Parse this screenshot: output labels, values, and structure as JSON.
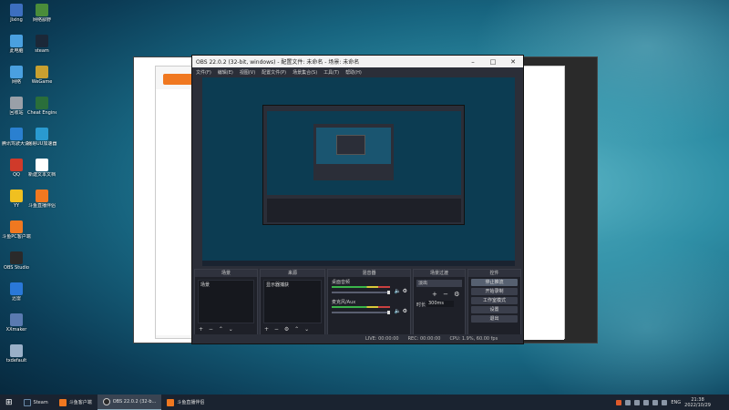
{
  "desktop": {
    "icons": [
      {
        "label": "Jixing",
        "color": "#3d6fbf"
      },
      {
        "label": "网络鄙野",
        "color": "#4a8c3a"
      },
      {
        "label": "此电脑",
        "color": "#4aa0e0"
      },
      {
        "label": "steam",
        "color": "#1b2838"
      },
      {
        "label": "网络",
        "color": "#4aa0e0"
      },
      {
        "label": "WeGame",
        "color": "#c8a030"
      },
      {
        "label": "回收站",
        "color": "#9aa0a8"
      },
      {
        "label": "Cheat Engine",
        "color": "#2a6e3a"
      },
      {
        "label": "腾讯驾驶大说器",
        "color": "#2a80d0"
      },
      {
        "label": "网易UU加速器",
        "color": "#2a9ad0"
      },
      {
        "label": "QQ",
        "color": "#d03a2a"
      },
      {
        "label": "新建文本文档",
        "color": "#ffffff"
      },
      {
        "label": "YY",
        "color": "#f0c020"
      },
      {
        "label": "斗鱼直播伴侣",
        "color": "#f07820"
      },
      {
        "label": "斗鱼PC客户端",
        "color": "#f07820"
      },
      {
        "label": "OBS Studio",
        "color": "#2a2a2a"
      },
      {
        "label": "迅雷",
        "color": "#2a78d8"
      },
      {
        "label": "XXmaker",
        "color": "#5a7ab0"
      },
      {
        "label": "txdefault",
        "color": "#9ab0c8"
      }
    ]
  },
  "obs": {
    "title": "OBS 22.0.2 (32-bit, windows) - 配置文件: 未命名 - 场景: 未命名",
    "menu": [
      "文件(F)",
      "编辑(E)",
      "视图(V)",
      "配置文件(P)",
      "场景集合(S)",
      "工具(T)",
      "帮助(H)"
    ],
    "docks": {
      "scenes": {
        "title": "场景",
        "item": "场景"
      },
      "sources": {
        "title": "来源",
        "item": "显示器捕获"
      },
      "mixer": {
        "title": "混音器",
        "track1": "桌面音频",
        "track2": "麦克风/Aux"
      },
      "transitions": {
        "title": "场景过渡",
        "type": "淡出",
        "duration_label": "时长",
        "duration": "300ms"
      },
      "controls": {
        "title": "控件",
        "buttons": [
          "停止推流",
          "开始录制",
          "工作室模式",
          "设置",
          "退出"
        ]
      }
    },
    "status": {
      "live": "LIVE: 00:00:00",
      "rec": "REC: 00:00:00",
      "cpu": "CPU: 1.9%, 60.00 fps"
    }
  },
  "taskbar": {
    "items": [
      {
        "label": "Steam",
        "color": "#1b2838"
      },
      {
        "label": "斗鱼客户端",
        "color": "#f07820"
      },
      {
        "label": "OBS 22.0.2 (32-b...",
        "color": "#2a2a2a"
      },
      {
        "label": "斗鱼直播伴侣",
        "color": "#f07820"
      }
    ],
    "lang": "ENG",
    "time": "21:38",
    "date": "2022/10/29"
  },
  "colors": {
    "accent": "#f07820",
    "obs_bg": "#2b2e38"
  }
}
